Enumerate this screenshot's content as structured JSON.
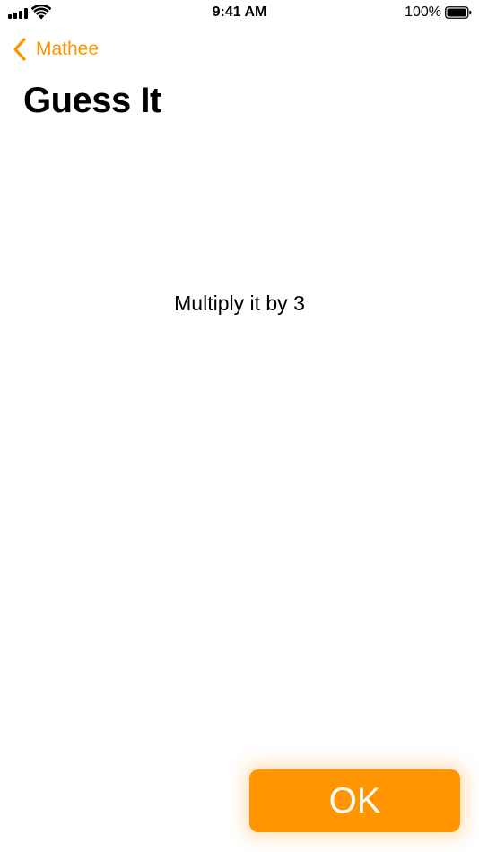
{
  "status_bar": {
    "time": "9:41 AM",
    "battery_percent": "100%",
    "battery_level": 1.0,
    "signal_bars": 4,
    "icons": [
      "signal-icon",
      "wifi-icon",
      "battery-icon"
    ]
  },
  "nav": {
    "back_label": "Mathee",
    "back_icon": "chevron-left-icon"
  },
  "page": {
    "title": "Guess It",
    "instruction": "Multiply it by 3"
  },
  "actions": {
    "ok_label": "OK"
  },
  "colors": {
    "accent": "#FF9500",
    "text": "#000000",
    "background": "#FFFFFF",
    "button_text": "#FFFFFF"
  }
}
